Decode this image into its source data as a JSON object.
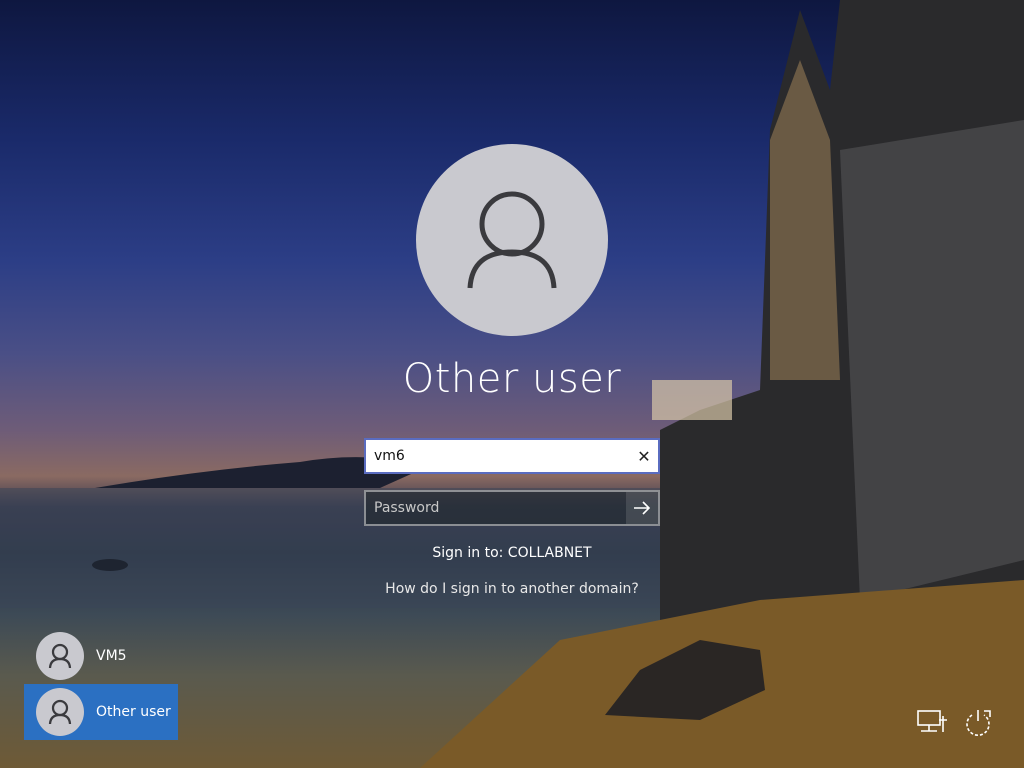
{
  "signin": {
    "display_name": "Other user",
    "username_value": "vm6",
    "password_placeholder": "Password",
    "sign_in_to": "Sign in to: COLLABNET",
    "domain_help_link": "How do I sign in to another domain?"
  },
  "user_list": [
    {
      "label": "VM5",
      "selected": false
    },
    {
      "label": "Other user",
      "selected": true
    }
  ],
  "icons": {
    "clear": "close-icon",
    "submit": "arrow-right-icon",
    "network": "network-icon",
    "power": "power-icon"
  },
  "colors": {
    "selected_user_bg": "#2b70c2",
    "avatar_bg": "#c9c9cf"
  }
}
